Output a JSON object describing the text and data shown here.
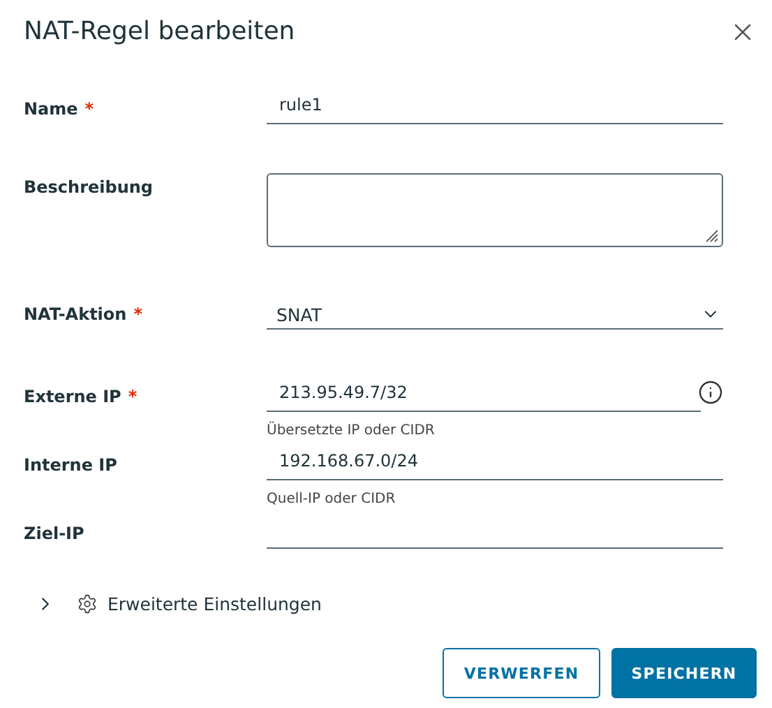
{
  "dialog": {
    "title": "NAT-Regel bearbeiten",
    "required_symbol": "*"
  },
  "fields": [
    {
      "kind": "text",
      "label": "Name",
      "required": true,
      "value": "rule1",
      "info": false
    },
    {
      "kind": "textarea",
      "label": "Beschreibung",
      "required": false,
      "info": false
    },
    {
      "kind": "select",
      "label": "NAT-Aktion",
      "required": true,
      "value": "SNAT",
      "info": false
    },
    {
      "kind": "text",
      "label": "Externe IP",
      "required": true,
      "value": "213.95.49.7/32",
      "helper": "Übersetzte IP oder CIDR",
      "info": true
    },
    {
      "kind": "text",
      "label": "Interne IP",
      "required": false,
      "value": "192.168.67.0/24",
      "helper": "Quell-IP oder CIDR",
      "info": false
    },
    {
      "kind": "text",
      "label": "Ziel-IP",
      "required": false,
      "info": false
    }
  ],
  "advanced": {
    "label": "Erweiterte Einstellungen",
    "expanded": false
  },
  "buttons": [
    {
      "label": "VERWERFEN",
      "kind": "outline"
    },
    {
      "label": "SPEICHERN",
      "kind": "primary"
    }
  ]
}
